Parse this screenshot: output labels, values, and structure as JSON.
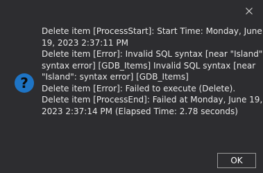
{
  "dialog": {
    "message_lines": [
      "Delete item [ProcessStart]: Start Time: Monday, June",
      "19, 2023 2:37:11 PM",
      "Delete item [Error]: Invalid SQL syntax [near \"Island\":",
      "syntax error] [GDB_Items] Invalid SQL syntax [near",
      "\"Island\": syntax error] [GDB_Items]",
      "Delete item [Error]: Failed to execute (Delete).",
      "Delete item [ProcessEnd]: Failed at Monday, June 19,",
      "2023 2:37:14 PM (Elapsed Time: 2.78 seconds)"
    ],
    "ok_label": "OK",
    "icon": "question-icon",
    "close_icon": "close-icon"
  },
  "colors": {
    "background": "#2d2d30",
    "text": "#e8e8e8",
    "icon_blue": "#1e74c5",
    "button_border": "#9a9a9a"
  }
}
